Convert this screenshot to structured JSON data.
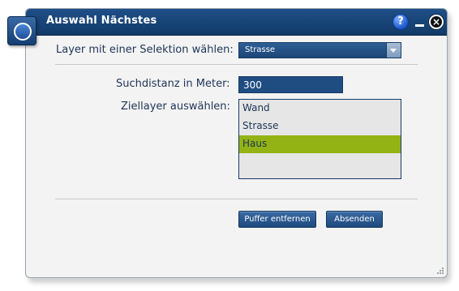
{
  "dialog": {
    "title": "Auswahl Nächstes",
    "help_glyph": "?",
    "close_glyph": "×"
  },
  "form": {
    "layer_label": "Layer mit einer Selektion wählen:",
    "layer_selected": "Strasse",
    "distance_label": "Suchdistanz in Meter:",
    "distance_value": "300",
    "target_label": "Ziellayer auswählen:",
    "target_items": [
      "Wand",
      "Strasse",
      "Haus"
    ],
    "target_selected": "Haus"
  },
  "buttons": {
    "clear_buffer": "Puffer entfernen",
    "submit": "Absenden"
  },
  "colors": {
    "titlebar": "#1a4677",
    "selection": "#93b314",
    "label_text": "#1d3557"
  },
  "icons": [
    "app-icon",
    "help-icon",
    "minimize-icon",
    "close-icon",
    "dropdown-arrow-icon",
    "resize-grip-icon"
  ]
}
